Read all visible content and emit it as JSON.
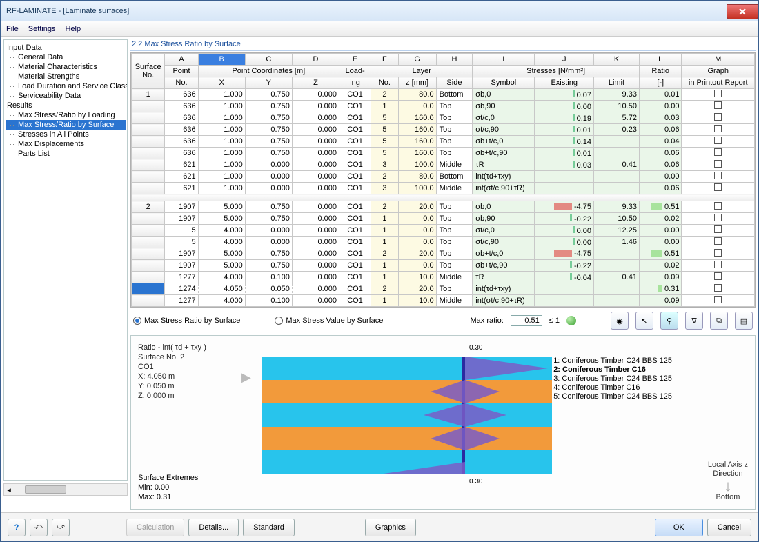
{
  "window": {
    "title": "RF-LAMINATE - [Laminate surfaces]"
  },
  "menu": {
    "file": "File",
    "settings": "Settings",
    "help": "Help"
  },
  "tree": {
    "input": "Input Data",
    "input_items": [
      "General Data",
      "Material Characteristics",
      "Material Strengths",
      "Load Duration and Service Class",
      "Serviceability Data"
    ],
    "results": "Results",
    "result_items": [
      "Max Stress/Ratio by Loading",
      "Max Stress/Ratio by Surface",
      "Stresses in All Points",
      "Max Displacements",
      "Parts List"
    ],
    "selected": "Max Stress/Ratio by Surface"
  },
  "section": {
    "title": "2.2 Max Stress Ratio by Surface"
  },
  "headers": {
    "letters": [
      "A",
      "B",
      "C",
      "D",
      "E",
      "F",
      "G",
      "H",
      "I",
      "J",
      "K",
      "L",
      "M"
    ],
    "surface": "Surface",
    "no_sub": "No.",
    "point": "Point",
    "coords": "Point Coordinates [m]",
    "x": "X",
    "y": "Y",
    "z": "Z",
    "load": "Load-",
    "ing": "ing",
    "layer": "Layer",
    "lno": "No.",
    "zm": "z [mm]",
    "side": "Side",
    "stresses": "Stresses [N/mm²]",
    "symbol": "Symbol",
    "exist": "Existing",
    "limit": "Limit",
    "ratio": "Ratio",
    "dash": "[-]",
    "graph": "Graph",
    "printout": "in Printout Report"
  },
  "rows": [
    {
      "surf": "1",
      "pt": "636",
      "x": "1.000",
      "y": "0.750",
      "z": "0.000",
      "lo": "CO1",
      "ln": "2",
      "zm": "80.0",
      "side": "Bottom",
      "sym": "σb,0",
      "ex": "0.07",
      "li": "9.33",
      "ra": "0.01"
    },
    {
      "surf": "",
      "pt": "636",
      "x": "1.000",
      "y": "0.750",
      "z": "0.000",
      "lo": "CO1",
      "ln": "1",
      "zm": "0.0",
      "side": "Top",
      "sym": "σb,90",
      "ex": "0.00",
      "li": "10.50",
      "ra": "0.00"
    },
    {
      "surf": "",
      "pt": "636",
      "x": "1.000",
      "y": "0.750",
      "z": "0.000",
      "lo": "CO1",
      "ln": "5",
      "zm": "160.0",
      "side": "Top",
      "sym": "σt/c,0",
      "ex": "0.19",
      "li": "5.72",
      "ra": "0.03"
    },
    {
      "surf": "",
      "pt": "636",
      "x": "1.000",
      "y": "0.750",
      "z": "0.000",
      "lo": "CO1",
      "ln": "5",
      "zm": "160.0",
      "side": "Top",
      "sym": "σt/c,90",
      "ex": "0.01",
      "li": "0.23",
      "ra": "0.06"
    },
    {
      "surf": "",
      "pt": "636",
      "x": "1.000",
      "y": "0.750",
      "z": "0.000",
      "lo": "CO1",
      "ln": "5",
      "zm": "160.0",
      "side": "Top",
      "sym": "σb+t/c,0",
      "ex": "0.14",
      "li": "",
      "ra": "0.04"
    },
    {
      "surf": "",
      "pt": "636",
      "x": "1.000",
      "y": "0.750",
      "z": "0.000",
      "lo": "CO1",
      "ln": "5",
      "zm": "160.0",
      "side": "Top",
      "sym": "σb+t/c,90",
      "ex": "0.01",
      "li": "",
      "ra": "0.06"
    },
    {
      "surf": "",
      "pt": "621",
      "x": "1.000",
      "y": "0.000",
      "z": "0.000",
      "lo": "CO1",
      "ln": "3",
      "zm": "100.0",
      "side": "Middle",
      "sym": "τR",
      "ex": "0.03",
      "li": "0.41",
      "ra": "0.06"
    },
    {
      "surf": "",
      "pt": "621",
      "x": "1.000",
      "y": "0.000",
      "z": "0.000",
      "lo": "CO1",
      "ln": "2",
      "zm": "80.0",
      "side": "Bottom",
      "sym": "int(τd+τxy)",
      "ex": "",
      "li": "",
      "ra": "0.00"
    },
    {
      "surf": "",
      "pt": "621",
      "x": "1.000",
      "y": "0.000",
      "z": "0.000",
      "lo": "CO1",
      "ln": "3",
      "zm": "100.0",
      "side": "Middle",
      "sym": "int(σt/c,90+τR)",
      "ex": "",
      "li": "",
      "ra": "0.06"
    },
    {
      "gap": true
    },
    {
      "surf": "2",
      "pt": "1907",
      "x": "5.000",
      "y": "0.750",
      "z": "0.000",
      "lo": "CO1",
      "ln": "2",
      "zm": "20.0",
      "side": "Top",
      "sym": "σb,0",
      "ex": "-4.75",
      "li": "9.33",
      "ra": "0.51",
      "exbar": "red",
      "rabar": "grn"
    },
    {
      "surf": "",
      "pt": "1907",
      "x": "5.000",
      "y": "0.750",
      "z": "0.000",
      "lo": "CO1",
      "ln": "1",
      "zm": "0.0",
      "side": "Top",
      "sym": "σb,90",
      "ex": "-0.22",
      "li": "10.50",
      "ra": "0.02"
    },
    {
      "surf": "",
      "pt": "5",
      "x": "4.000",
      "y": "0.000",
      "z": "0.000",
      "lo": "CO1",
      "ln": "1",
      "zm": "0.0",
      "side": "Top",
      "sym": "σt/c,0",
      "ex": "0.00",
      "li": "12.25",
      "ra": "0.00"
    },
    {
      "surf": "",
      "pt": "5",
      "x": "4.000",
      "y": "0.000",
      "z": "0.000",
      "lo": "CO1",
      "ln": "1",
      "zm": "0.0",
      "side": "Top",
      "sym": "σt/c,90",
      "ex": "0.00",
      "li": "1.46",
      "ra": "0.00"
    },
    {
      "surf": "",
      "pt": "1907",
      "x": "5.000",
      "y": "0.750",
      "z": "0.000",
      "lo": "CO1",
      "ln": "2",
      "zm": "20.0",
      "side": "Top",
      "sym": "σb+t/c,0",
      "ex": "-4.75",
      "li": "",
      "ra": "0.51",
      "exbar": "red",
      "rabar": "grn"
    },
    {
      "surf": "",
      "pt": "1907",
      "x": "5.000",
      "y": "0.750",
      "z": "0.000",
      "lo": "CO1",
      "ln": "1",
      "zm": "0.0",
      "side": "Top",
      "sym": "σb+t/c,90",
      "ex": "-0.22",
      "li": "",
      "ra": "0.02"
    },
    {
      "surf": "",
      "pt": "1277",
      "x": "4.000",
      "y": "0.100",
      "z": "0.000",
      "lo": "CO1",
      "ln": "1",
      "zm": "10.0",
      "side": "Middle",
      "sym": "τR",
      "ex": "-0.04",
      "li": "0.41",
      "ra": "0.09"
    },
    {
      "surf": "",
      "pt": "1274",
      "x": "4.050",
      "y": "0.050",
      "z": "0.000",
      "lo": "CO1",
      "ln": "2",
      "zm": "20.0",
      "side": "Top",
      "sym": "int(τd+τxy)",
      "ex": "",
      "li": "",
      "ra": "0.31",
      "rabar": "grn",
      "selrow": true
    },
    {
      "surf": "",
      "pt": "1277",
      "x": "4.000",
      "y": "0.100",
      "z": "0.000",
      "lo": "CO1",
      "ln": "1",
      "zm": "10.0",
      "side": "Middle",
      "sym": "int(σt/c,90+τR)",
      "ex": "",
      "li": "",
      "ra": "0.09"
    }
  ],
  "mid": {
    "r1": "Max Stress Ratio by Surface",
    "r2": "Max Stress Value by Surface",
    "maxratio_lbl": "Max ratio:",
    "maxratio": "0.51",
    "cond": "≤ 1"
  },
  "diagram": {
    "title": "Ratio - int( τd + τxy )",
    "l1": "Surface No. 2",
    "l2": "CO1",
    "l3": "X: 4.050 m",
    "l4": "Y: 0.050 m",
    "l5": "Z: 0.000 m",
    "ext_t": "Surface Extremes",
    "ext_min": "Min: 0.00",
    "ext_max": "Max: 0.31",
    "top_tick": "0.30",
    "bot_tick": "0.30",
    "legend": [
      "1: Coniferous Timber C24 BBS 125",
      "2: Coniferous Timber C16",
      "3: Coniferous Timber C24 BBS 125",
      "4: Coniferous Timber C16",
      "5: Coniferous Timber C24 BBS 125"
    ],
    "axis1": "Local Axis z",
    "axis2": "Direction",
    "axis3": "Bottom",
    "axis_arrow": "↓"
  },
  "foot": {
    "calc": "Calculation",
    "details": "Details...",
    "standard": "Standard",
    "graphics": "Graphics",
    "ok": "OK",
    "cancel": "Cancel"
  }
}
